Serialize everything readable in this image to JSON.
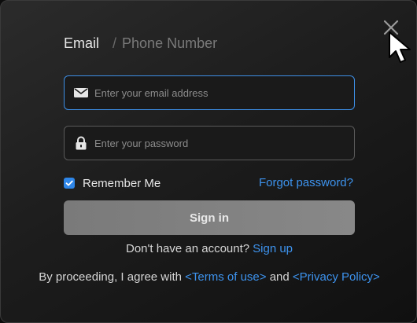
{
  "tabs": {
    "email": "Email",
    "separator": "/",
    "phone": "Phone Number"
  },
  "email_field": {
    "placeholder": "Enter your email address",
    "value": "",
    "icon": "envelope-icon"
  },
  "password_field": {
    "placeholder": "Enter your password",
    "value": "",
    "icon": "lock-icon"
  },
  "remember": {
    "label": "Remember Me",
    "checked": true
  },
  "forgot_label": "Forgot password?",
  "signin_label": "Sign in",
  "signup": {
    "prompt": "Don't have an account?",
    "link": "Sign up"
  },
  "terms": {
    "prefix": "By proceeding, I agree with",
    "terms_link": "<Terms of use>",
    "conjunction": "and",
    "privacy_link": "<Privacy Policy>"
  },
  "colors": {
    "accent": "#3d93ee",
    "focus_border": "#3d8fe6",
    "checkbox": "#2e86e8",
    "button": "#808080"
  }
}
